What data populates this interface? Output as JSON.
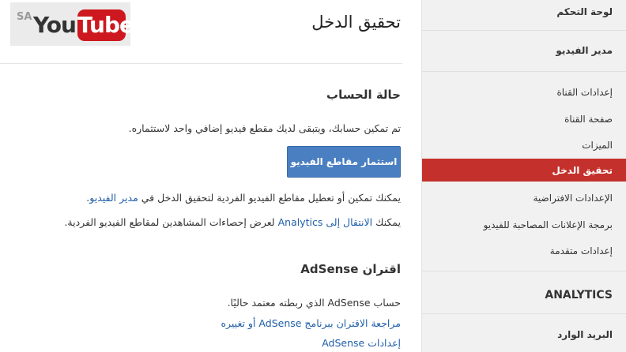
{
  "logo": {
    "region": "SA",
    "you": "You",
    "tube": "Tube"
  },
  "page": {
    "title": "تحقيق الدخل"
  },
  "account_status": {
    "title": "حالة الحساب",
    "message": "تم تمكين حسابك، ويتبقى لديك مقطع فيديو إضافي واحد لاستثماره.",
    "button_label": "استثمار مقاطع الفيديو",
    "info1_pre": "يمكنك تمكين أو تعطيل مقاطع الفيديو الفردية لتحقيق الدخل في",
    "info1_link": "مدير الفيديو",
    "info1_post": ".",
    "info2_pre": "يمكنك",
    "info2_link": "الانتقال إلى Analytics",
    "info2_post": "لعرض إحصاءات المشاهدين لمقاطع الفيديو الفردية."
  },
  "adsense": {
    "title": "اقتران AdSense",
    "status": "حساب AdSense الذي ربطته معتمد حاليًا.",
    "link1": "مراجعة الاقتران ببرنامج AdSense أو تغييره",
    "link2": "إعدادات AdSense"
  },
  "sidebar": {
    "dashboard": "لوحة التحكم",
    "video_manager": "مدير الفيديو",
    "channel_settings": "إعدادات القناة",
    "channel_page": "صفحة القناة",
    "features": "الميزات",
    "monetization": "تحقيق الدخل",
    "defaults": "الإعدادات الافتراضية",
    "promoted_videos": "برمجة الإعلانات المصاحبة للفيديو",
    "advanced": "إعدادات متقدمة",
    "analytics": "ANALYTICS",
    "inbox": "البريد الوارد"
  },
  "colors": {
    "accent": "#c4302b",
    "button": "#4a7fc1",
    "link": "#1f5ea8"
  }
}
